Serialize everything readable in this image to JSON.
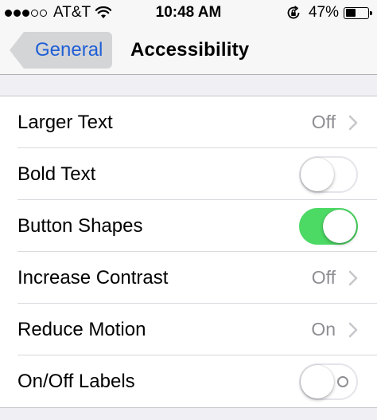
{
  "status_bar": {
    "carrier": "AT&T",
    "time": "10:48 AM",
    "battery_percent": "47%",
    "battery_level": 0.47,
    "signal_bars_filled": 3,
    "signal_bars_total": 5,
    "icons": [
      "wifi-icon",
      "rotation-lock-icon",
      "battery-icon"
    ]
  },
  "nav": {
    "back_label": "General",
    "title": "Accessibility"
  },
  "colors": {
    "accent": "#1f5fd6",
    "toggle_on": "#4cd964",
    "secondary_text": "#8e8e93"
  },
  "settings": [
    {
      "label": "Larger Text",
      "value": "Off",
      "type": "disclosure"
    },
    {
      "label": "Bold Text",
      "type": "toggle",
      "on": false
    },
    {
      "label": "Button Shapes",
      "type": "toggle",
      "on": true
    },
    {
      "label": "Increase Contrast",
      "value": "Off",
      "type": "disclosure"
    },
    {
      "label": "Reduce Motion",
      "value": "On",
      "type": "disclosure"
    },
    {
      "label": "On/Off Labels",
      "type": "toggle",
      "on": false,
      "shows_off_label": true
    }
  ]
}
